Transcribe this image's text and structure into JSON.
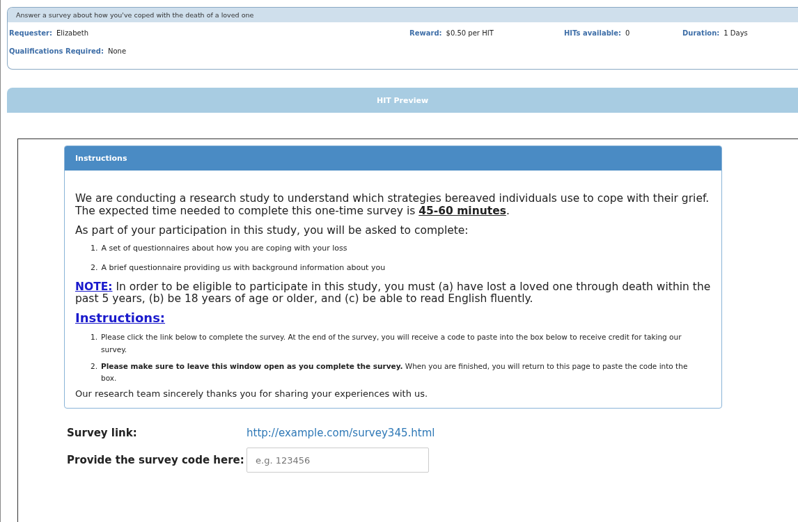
{
  "hit_summary": {
    "title": "Answer a survey about how you've coped with the death of a loved one",
    "fields": [
      {
        "label": "Requester:",
        "value": "Elizabeth"
      },
      {
        "label": "Reward:",
        "value": "$0.50 per HIT"
      },
      {
        "label": "HITs available:",
        "value": "0"
      },
      {
        "label": "Duration:",
        "value": "1 Days"
      }
    ],
    "qualifications": {
      "label": "Qualifications Required:",
      "value": "None"
    }
  },
  "preview_bar": {
    "title": "HIT Preview"
  },
  "instructions_panel": {
    "title": "Instructions",
    "intro": "We are conducting a research study to understand which strategies bereaved individuals use to cope with their grief. The expected time needed to complete this one-time survey is **45-60 minutes**.",
    "lead": "As part of your participation in this study, you will be asked to complete:",
    "tasks": [
      {
        "marker": "1.",
        "text": "A set of questionnaires about how you are coping with your loss"
      },
      {
        "marker": "2.",
        "text": "A brief questionnaire providing us with background information about you"
      }
    ],
    "note": "**NOTE:** In order to be eligible to participate in this study, you must (a) have lost a loved one through death within the past 5 years, (b) be 18 years of age or older, and (c) be able to read English fluently.",
    "heading": "Instructions:",
    "steps": [
      {
        "marker": "1.",
        "text": "Please click the link below to complete the survey. At the end of the survey, you will receive a code to paste into the box below to receive credit for taking our survey."
      },
      {
        "marker": "2.",
        "text": "**Please make sure to leave this window open as you complete the survey.** When you are finished, you will return to this page to paste the code into the box."
      }
    ],
    "thanks": "Our research team sincerely thanks you for sharing your experiences with us."
  },
  "survey_link": {
    "label": "Survey link:",
    "url": "http://example.com/survey345.html"
  },
  "survey_code": {
    "label": "Provide the survey code here:",
    "placeholder": "e.g. 123456"
  }
}
